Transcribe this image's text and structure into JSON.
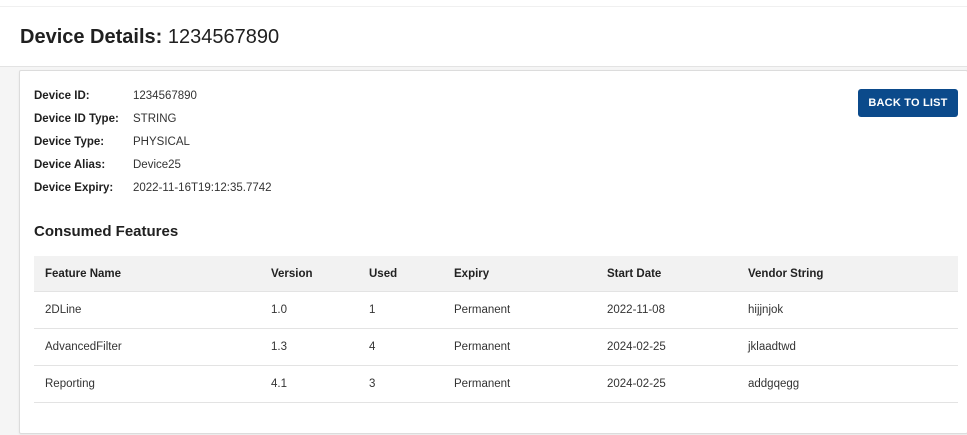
{
  "header": {
    "title_label": "Device Details:",
    "title_value": "1234567890"
  },
  "details": [
    {
      "label": "Device ID:",
      "value": "1234567890"
    },
    {
      "label": "Device ID Type:",
      "value": "STRING"
    },
    {
      "label": "Device Type:",
      "value": "PHYSICAL"
    },
    {
      "label": "Device Alias:",
      "value": "Device25"
    },
    {
      "label": "Device Expiry:",
      "value": "2022-11-16T19:12:35.7742"
    }
  ],
  "back_button": {
    "label": "BACK TO LIST"
  },
  "consumed": {
    "title": "Consumed Features",
    "columns": [
      "Feature Name",
      "Version",
      "Used",
      "Expiry",
      "Start Date",
      "Vendor String"
    ],
    "rows": [
      [
        "2DLine",
        "1.0",
        "1",
        "Permanent",
        "2022-11-08",
        "hijjnjok"
      ],
      [
        "AdvancedFilter",
        "1.3",
        "4",
        "Permanent",
        "2024-02-25",
        "jklaadtwd"
      ],
      [
        "Reporting",
        "4.1",
        "3",
        "Permanent",
        "2024-02-25",
        "addgqegg"
      ]
    ]
  },
  "colors": {
    "accent": "#0b4a8b",
    "header_bg": "#f2f2f2"
  }
}
